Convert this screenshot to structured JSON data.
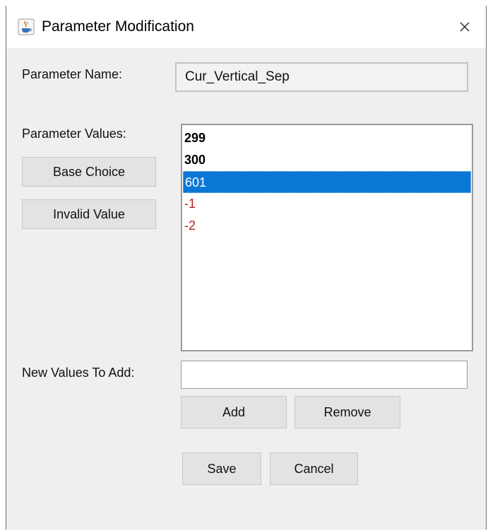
{
  "window": {
    "title": "Parameter Modification",
    "close_icon": "close-icon",
    "app_icon": "java-cup-icon"
  },
  "form": {
    "name_label": "Parameter Name:",
    "name_value": "Cur_Vertical_Sep",
    "values_label": "Parameter Values:",
    "base_choice_label": "Base Choice",
    "invalid_value_label": "Invalid Value",
    "values": [
      {
        "text": "299",
        "kind": "base"
      },
      {
        "text": "300",
        "kind": "base"
      },
      {
        "text": "601",
        "kind": "normal",
        "selected": true
      },
      {
        "text": "-1",
        "kind": "invalid"
      },
      {
        "text": "-2",
        "kind": "invalid"
      }
    ],
    "new_values_label": "New Values To Add:",
    "new_values_value": "",
    "add_label": "Add",
    "remove_label": "Remove",
    "save_label": "Save",
    "cancel_label": "Cancel"
  },
  "colors": {
    "selection": "#0b78d7",
    "invalid": "#b22222",
    "background": "#efefef"
  }
}
